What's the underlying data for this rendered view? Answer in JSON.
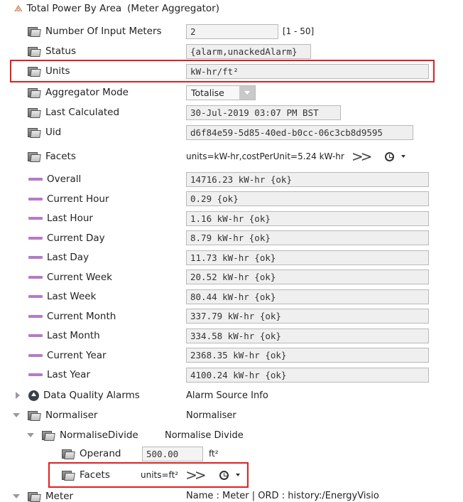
{
  "header": {
    "title": "Total Power By Area",
    "type": "(Meter Aggregator)"
  },
  "props": {
    "num_meters": {
      "label": "Number Of Input Meters",
      "value": "2",
      "range": "[1 - 50]"
    },
    "status": {
      "label": "Status",
      "value": "{alarm,unackedAlarm}"
    },
    "units": {
      "label": "Units",
      "value": "kW-hr/ft²"
    },
    "mode": {
      "label": "Aggregator Mode",
      "value": "Totalise"
    },
    "last_calc": {
      "label": "Last Calculated",
      "value": "30-Jul-2019 03:07 PM BST"
    },
    "uid": {
      "label": "Uid",
      "value": "d6f84e59-5d85-40ed-b0cc-06c3cb8d9595"
    },
    "facets": {
      "label": "Facets",
      "value": "units=kW-hr,costPerUnit=5.24 kW-hr"
    }
  },
  "readings": [
    {
      "label": "Overall",
      "value": "14716.23 kW-hr {ok}"
    },
    {
      "label": "Current Hour",
      "value": "0.29 {ok}"
    },
    {
      "label": "Last Hour",
      "value": "1.16 kW-hr {ok}"
    },
    {
      "label": "Current Day",
      "value": "8.79 kW-hr {ok}"
    },
    {
      "label": "Last Day",
      "value": "11.73 kW-hr {ok}"
    },
    {
      "label": "Current Week",
      "value": "20.52 kW-hr {ok}"
    },
    {
      "label": "Last Week",
      "value": "80.44 kW-hr {ok}"
    },
    {
      "label": "Current Month",
      "value": "337.79 kW-hr {ok}"
    },
    {
      "label": "Last Month",
      "value": "334.58 kW-hr {ok}"
    },
    {
      "label": "Current Year",
      "value": "2368.35 kW-hr {ok}"
    },
    {
      "label": "Last Year",
      "value": "4100.24 kW-hr {ok}"
    }
  ],
  "tree": {
    "dqa": {
      "label": "Data Quality Alarms",
      "value": "Alarm Source Info"
    },
    "normaliser": {
      "label": "Normaliser",
      "value": "Normaliser"
    },
    "normalise_divide": {
      "label": "NormaliseDivide",
      "value": "Normalise Divide"
    },
    "operand": {
      "label": "Operand",
      "value": "500.00",
      "unit": "ft²"
    },
    "nd_facets": {
      "label": "Facets",
      "value": "units=ft²"
    },
    "meter": {
      "label": "Meter",
      "value": "Name : Meter | ORD : history:/EnergyVisio"
    }
  },
  "colors": {
    "highlight": "#e02020",
    "numeric_icon": "#b57ac9"
  }
}
